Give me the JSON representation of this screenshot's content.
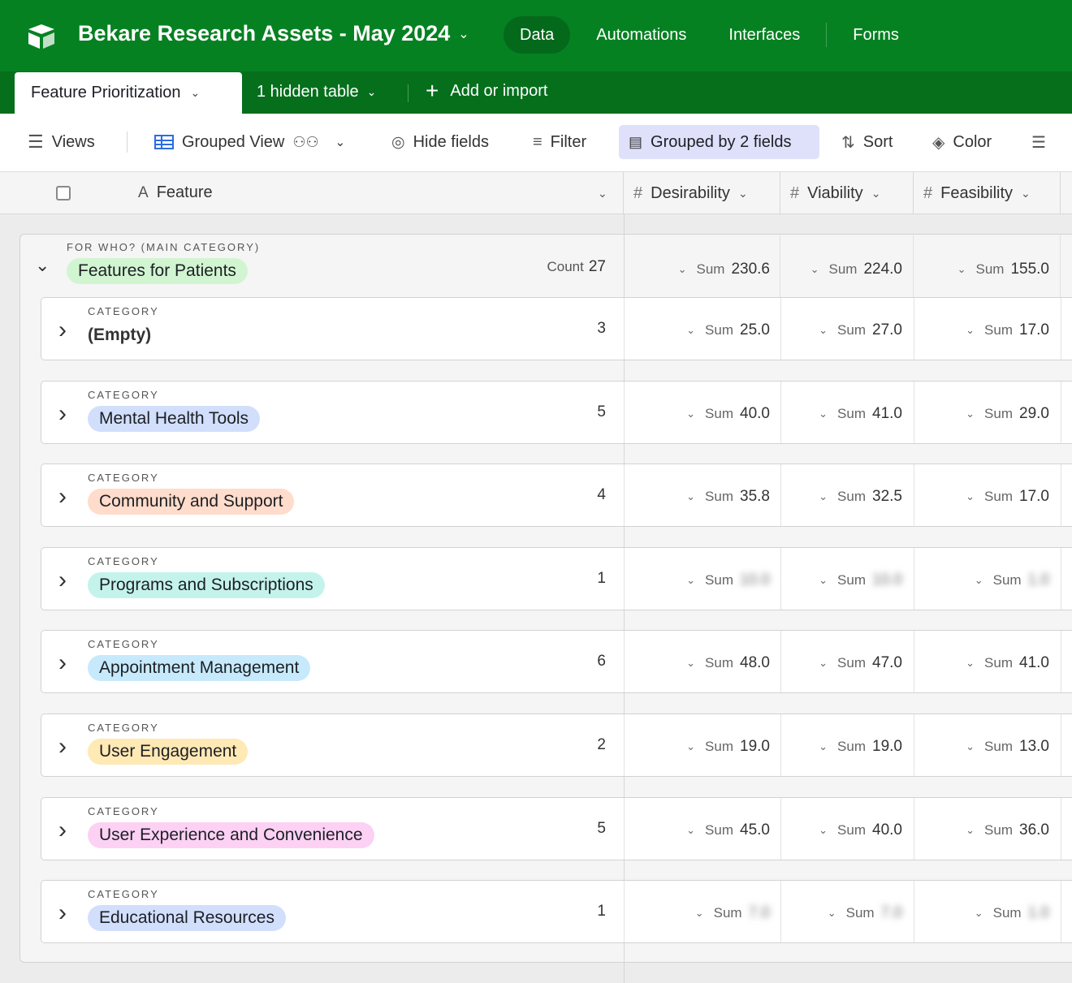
{
  "app": {
    "base_title": "Bekare Research Assets - May 2024",
    "nav": [
      "Data",
      "Automations",
      "Interfaces",
      "Forms"
    ],
    "active_nav": "Data"
  },
  "tables": {
    "active_table": "Feature Prioritization",
    "hidden_tables": "1 hidden table",
    "add_import": "Add or import"
  },
  "toolbar": {
    "views": "Views",
    "view_name": "Grouped View",
    "hide_fields": "Hide fields",
    "filter": "Filter",
    "grouped": "Grouped by 2 fields",
    "sort": "Sort",
    "color": "Color"
  },
  "columns": {
    "primary": "Feature",
    "fields": [
      "Desirability",
      "Viability",
      "Feasibility"
    ]
  },
  "group": {
    "label": "FOR WHO? (MAIN CATEGORY)",
    "name": "Features for Patients",
    "count_label": "Count",
    "count": "27",
    "sum_label": "Sum",
    "sums": [
      "230.6",
      "224.0",
      "155.0"
    ]
  },
  "subgroup_label": "CATEGORY",
  "subgroups": [
    {
      "name": "(Empty)",
      "count": "3",
      "sums": [
        "25.0",
        "27.0",
        "17.0"
      ],
      "color": "",
      "blurred": false
    },
    {
      "name": "Mental Health Tools",
      "count": "5",
      "sums": [
        "40.0",
        "41.0",
        "29.0"
      ],
      "color": "#d1dffc",
      "blurred": false
    },
    {
      "name": "Community and Support",
      "count": "4",
      "sums": [
        "35.8",
        "32.5",
        "17.0"
      ],
      "color": "#ffdccb",
      "blurred": false
    },
    {
      "name": "Programs and Subscriptions",
      "count": "1",
      "sums": [
        "10.0",
        "10.0",
        "1.0"
      ],
      "color": "#c4f3ec",
      "blurred": true
    },
    {
      "name": "Appointment Management",
      "count": "6",
      "sums": [
        "48.0",
        "47.0",
        "41.0"
      ],
      "color": "#c6eafc",
      "blurred": false
    },
    {
      "name": "User Engagement",
      "count": "2",
      "sums": [
        "19.0",
        "19.0",
        "13.0"
      ],
      "color": "#ffe9b4",
      "blurred": false
    },
    {
      "name": "User Experience and Convenience",
      "count": "5",
      "sums": [
        "45.0",
        "40.0",
        "36.0"
      ],
      "color": "#fcd1f4",
      "blurred": false
    },
    {
      "name": "Educational Resources",
      "count": "1",
      "sums": [
        "7.0",
        "7.0",
        "1.0"
      ],
      "color": "#d1dffc",
      "blurred": true
    }
  ],
  "colors": {
    "header_green": "#068122",
    "tabbar_green": "#056f1c",
    "group_pill": "#d2f5d1",
    "highlight": "#dfe1fb"
  }
}
